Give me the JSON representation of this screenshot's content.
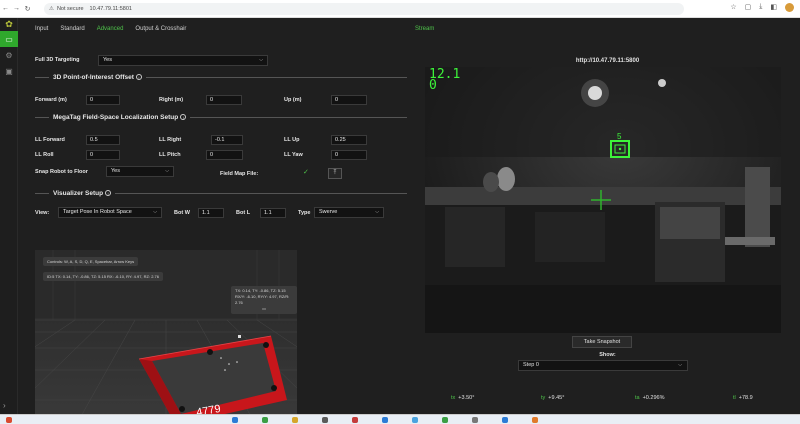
{
  "browser": {
    "security_text": "Not secure",
    "url": "10.47.79.11:5801"
  },
  "tabs": [
    "Input",
    "Standard",
    "Advanced",
    "Output & Crosshair"
  ],
  "active_tab": "Advanced",
  "stream_tab": "Stream",
  "targeting": {
    "label": "Full 3D Targeting",
    "value": "Yes"
  },
  "poi": {
    "title": "3D Point-of-Interest Offset",
    "forward_label": "Forward (m)",
    "forward_value": "0",
    "right_label": "Right (m)",
    "right_value": "0",
    "up_label": "Up (m)",
    "up_value": "0"
  },
  "megatag": {
    "title": "MegaTag Field-Space Localization Setup",
    "ll_forward_label": "LL Forward",
    "ll_forward_value": "0.5",
    "ll_right_label": "LL Right",
    "ll_right_value": "-0.1",
    "ll_up_label": "LL Up",
    "ll_up_value": "0.25",
    "ll_roll_label": "LL Roll",
    "ll_roll_value": "0",
    "ll_pitch_label": "LL Pitch",
    "ll_pitch_value": "0",
    "ll_yaw_label": "LL Yaw",
    "ll_yaw_value": "0",
    "snap_label": "Snap Robot to Floor",
    "snap_value": "Yes",
    "field_map_label": "Field Map File:"
  },
  "visualizer": {
    "title": "Visualizer Setup",
    "view_label": "View:",
    "view_value": "Target Pose In Robot Space",
    "botw_label": "Bot W",
    "botw_value": "1.1",
    "botl_label": "Bot L",
    "botl_value": "1.1",
    "type_label": "Type",
    "type_value": "Swerve",
    "controls_hint": "Controls: W, A, S, D, Q, E, Spacebar, Arrow Keys",
    "ids_line": "ID:5 TX: 0.14, TY: -0.86, TZ: 5.15 RX: -6.10, RY: 4.97, RZ: 2.76",
    "tip_line1": "TX: 0.14, TY: -0.86, TZ: 5.15",
    "tip_line2": "RX/Y: -6.10, RY/Y: 4.97, RZ/R: 2.76",
    "robot_number": "4779"
  },
  "stream": {
    "url": "http://10.47.79.11:5800",
    "overlay_line1": "12.1",
    "overlay_line2": "0",
    "tag_id": "5",
    "snapshot_label": "Take Snapshot",
    "show_label": "Show:",
    "show_value": "Step 0",
    "metrics": [
      {
        "key": "tx",
        "value": "+3.50°"
      },
      {
        "key": "ty",
        "value": "+9.45°"
      },
      {
        "key": "ta",
        "value": "+0.296%"
      },
      {
        "key": "tl",
        "value": "+78.9"
      }
    ]
  },
  "colors": {
    "accent": "#4ec34a",
    "robot": "#c8161b",
    "target": "#3df43a"
  }
}
